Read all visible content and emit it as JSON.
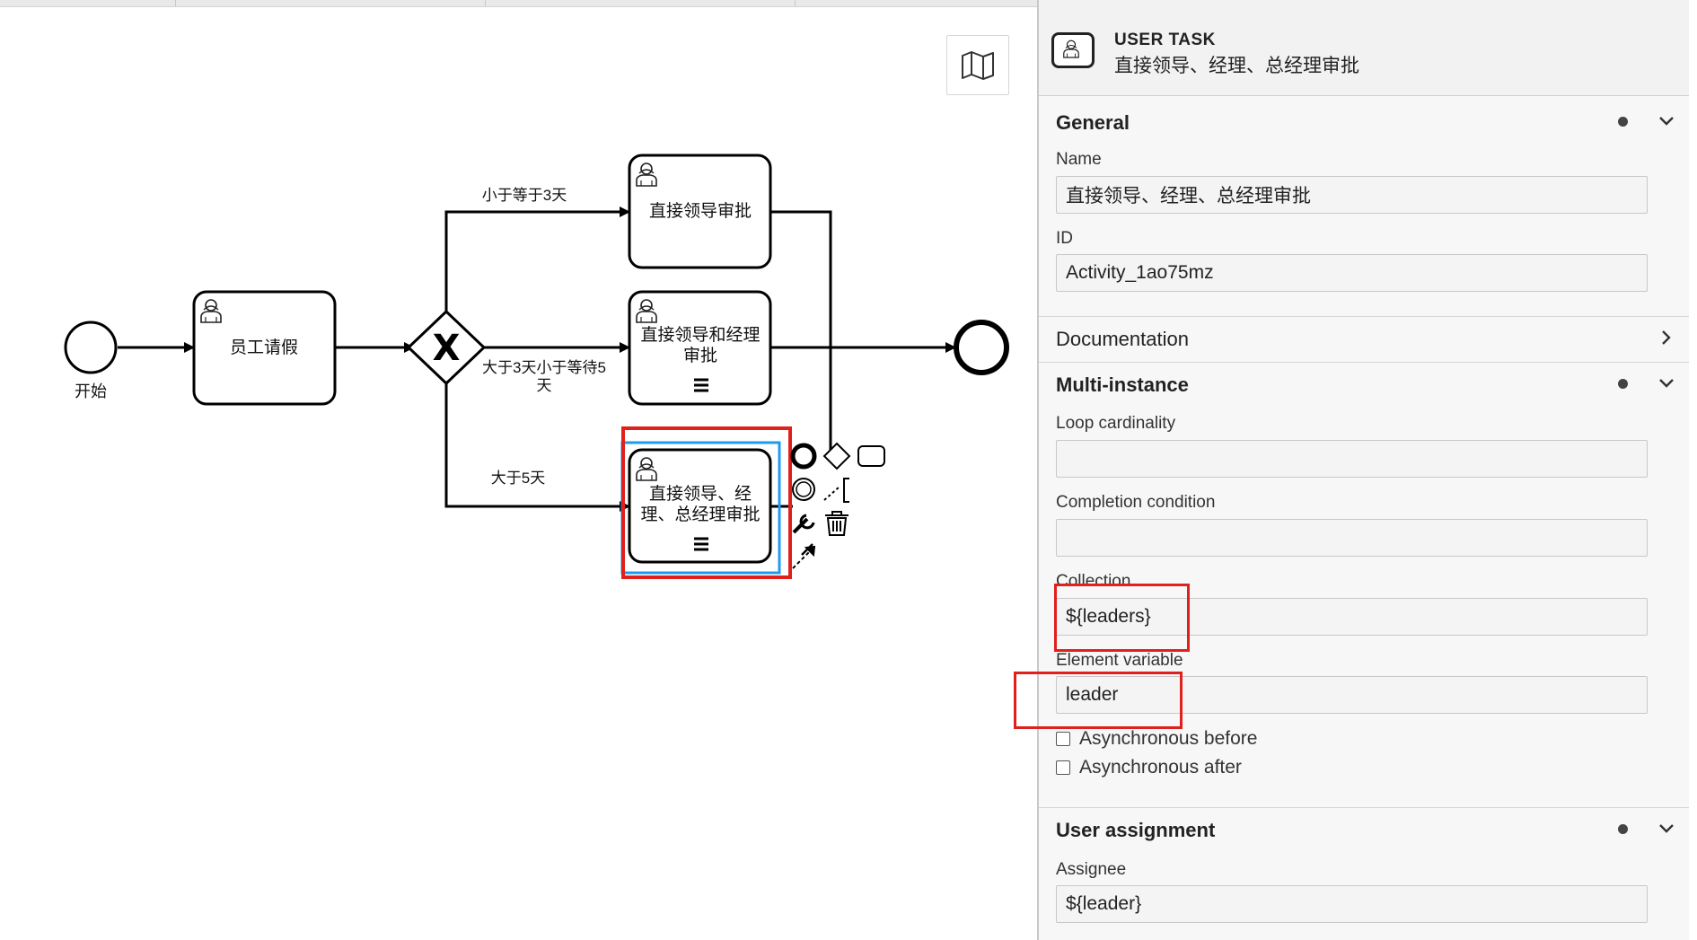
{
  "canvas": {
    "start_event_label": "开始",
    "task_employee_leave": "员工请假",
    "task_direct_lead": "直接领导审批",
    "task_lead_manager": "直接领导和经理审批",
    "task_all_approval": "直接领导、经理、总经理审批",
    "flow_le3": "小于等于3天",
    "flow_3to5": "大于3天小于等待5天",
    "flow_gt5": "大于5天",
    "gateway_symbol": "X",
    "highlight_color": "#e0201b",
    "selection_color": "#1e9bf0"
  },
  "panel": {
    "element_type": "USER TASK",
    "element_name": "直接领导、经理、总经理审批",
    "groups": {
      "general": "General",
      "documentation": "Documentation",
      "multi_instance": "Multi-instance",
      "user_assignment": "User assignment"
    },
    "general": {
      "name_label": "Name",
      "name_value": "直接领导、经理、总经理审批",
      "id_label": "ID",
      "id_value": "Activity_1ao75mz"
    },
    "multi_instance": {
      "loop_cardinality_label": "Loop cardinality",
      "loop_cardinality_value": "",
      "completion_condition_label": "Completion condition",
      "completion_condition_value": "",
      "collection_label": "Collection",
      "collection_value": "${leaders}",
      "element_variable_label": "Element variable",
      "element_variable_value": "leader",
      "async_before_label": "Asynchronous before",
      "async_after_label": "Asynchronous after"
    },
    "user_assignment": {
      "assignee_label": "Assignee",
      "assignee_value": "${leader}"
    }
  }
}
